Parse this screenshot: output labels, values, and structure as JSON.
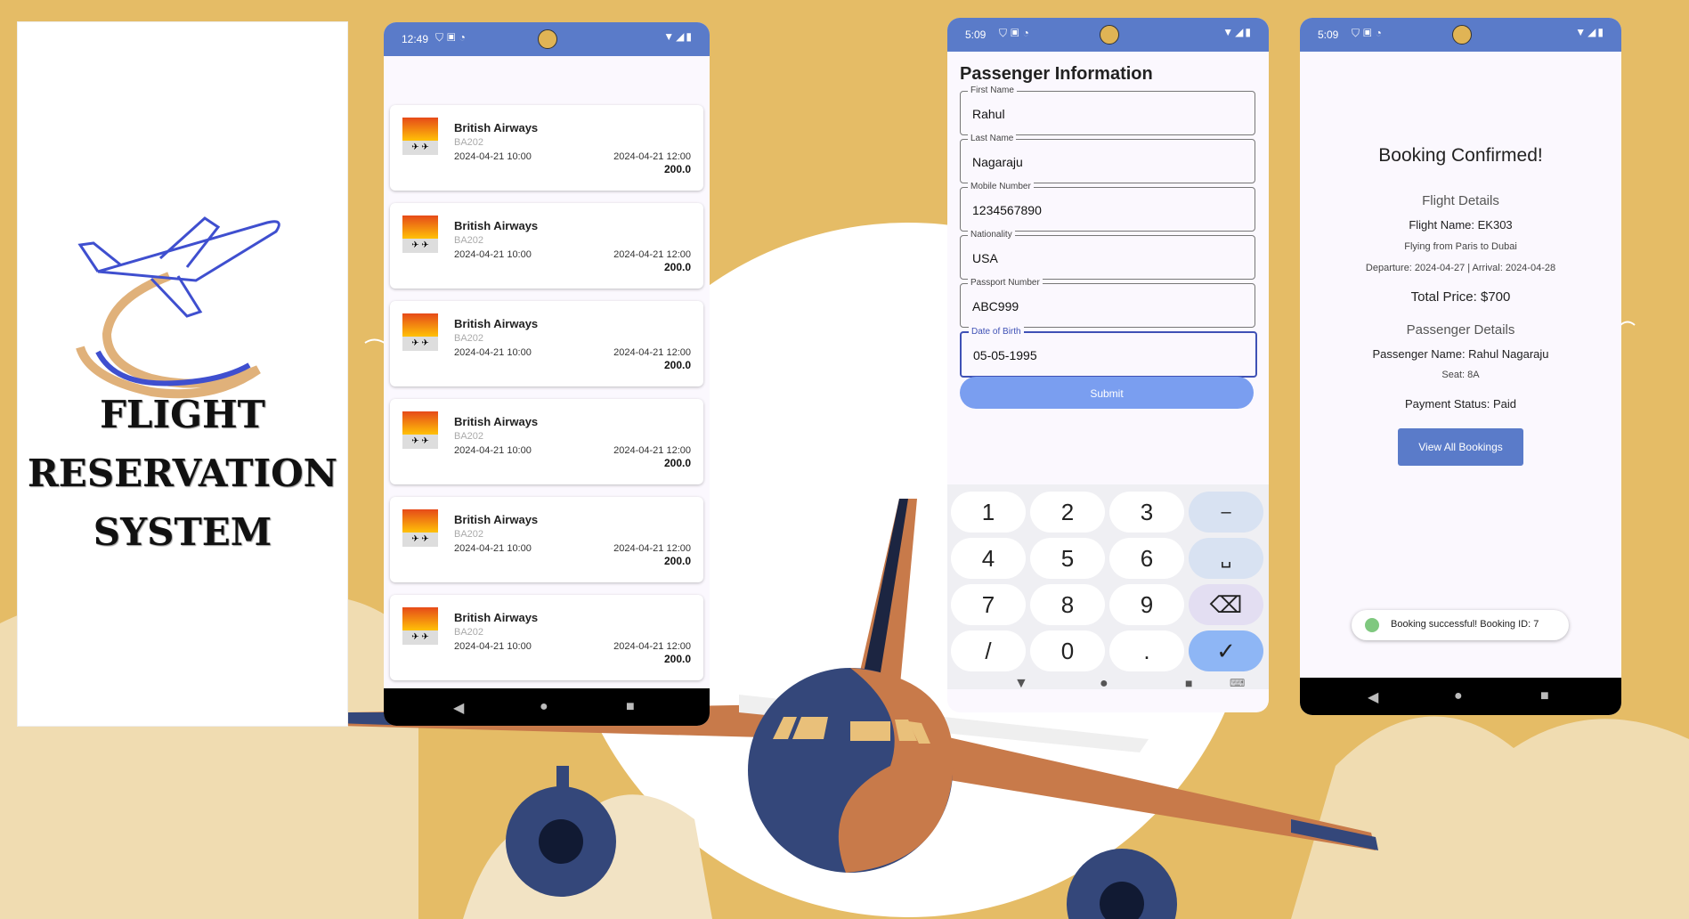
{
  "title_card": {
    "line1": "FLIGHT",
    "line2": "RESERVATION",
    "line3": "SYSTEM"
  },
  "phone_list": {
    "status_time": "12:49",
    "flights": [
      {
        "airline": "British Airways",
        "code": "BA202",
        "departure": "2024-04-21 10:00",
        "arrival": "2024-04-21 12:00",
        "price": "200.0"
      },
      {
        "airline": "British Airways",
        "code": "BA202",
        "departure": "2024-04-21 10:00",
        "arrival": "2024-04-21 12:00",
        "price": "200.0"
      },
      {
        "airline": "British Airways",
        "code": "BA202",
        "departure": "2024-04-21 10:00",
        "arrival": "2024-04-21 12:00",
        "price": "200.0"
      },
      {
        "airline": "British Airways",
        "code": "BA202",
        "departure": "2024-04-21 10:00",
        "arrival": "2024-04-21 12:00",
        "price": "200.0"
      },
      {
        "airline": "British Airways",
        "code": "BA202",
        "departure": "2024-04-21 10:00",
        "arrival": "2024-04-21 12:00",
        "price": "200.0"
      },
      {
        "airline": "British Airways",
        "code": "BA202",
        "departure": "2024-04-21 10:00",
        "arrival": "2024-04-21 12:00",
        "price": "200.0"
      }
    ]
  },
  "phone_form": {
    "status_time": "5:09",
    "title": "Passenger Information",
    "fields": [
      {
        "label": "First Name",
        "value": "Rahul"
      },
      {
        "label": "Last Name",
        "value": "Nagaraju"
      },
      {
        "label": "Mobile Number",
        "value": "1234567890"
      },
      {
        "label": "Nationality",
        "value": "USA"
      },
      {
        "label": "Passport Number",
        "value": "ABC999"
      },
      {
        "label": "Date of Birth",
        "value": "05-05-1995"
      }
    ],
    "submit_label": "Submit",
    "keys": [
      "1",
      "2",
      "3",
      "–",
      "4",
      "5",
      "6",
      "␣",
      "7",
      "8",
      "9",
      "⌫",
      "/",
      "0",
      ".",
      "✓"
    ]
  },
  "phone_confirm": {
    "status_time": "5:09",
    "title": "Booking Confirmed!",
    "flight_details_heading": "Flight Details",
    "flight_name": "Flight Name: EK303",
    "route": "Flying from Paris to Dubai",
    "dates": "Departure: 2024-04-27 | Arrival: 2024-04-28",
    "total_price": "Total Price: $700",
    "passenger_details_heading": "Passenger Details",
    "passenger_name": "Passenger Name: Rahul Nagaraju",
    "seat": "Seat: 8A",
    "payment_status": "Payment Status: Paid",
    "view_all_label": "View All Bookings",
    "toast": "Booking successful! Booking ID: 7"
  },
  "colors": {
    "background": "#E5BC66",
    "accent": "#5A7BC9",
    "plane_body": "#34477A",
    "plane_wing": "#C87A4A"
  }
}
